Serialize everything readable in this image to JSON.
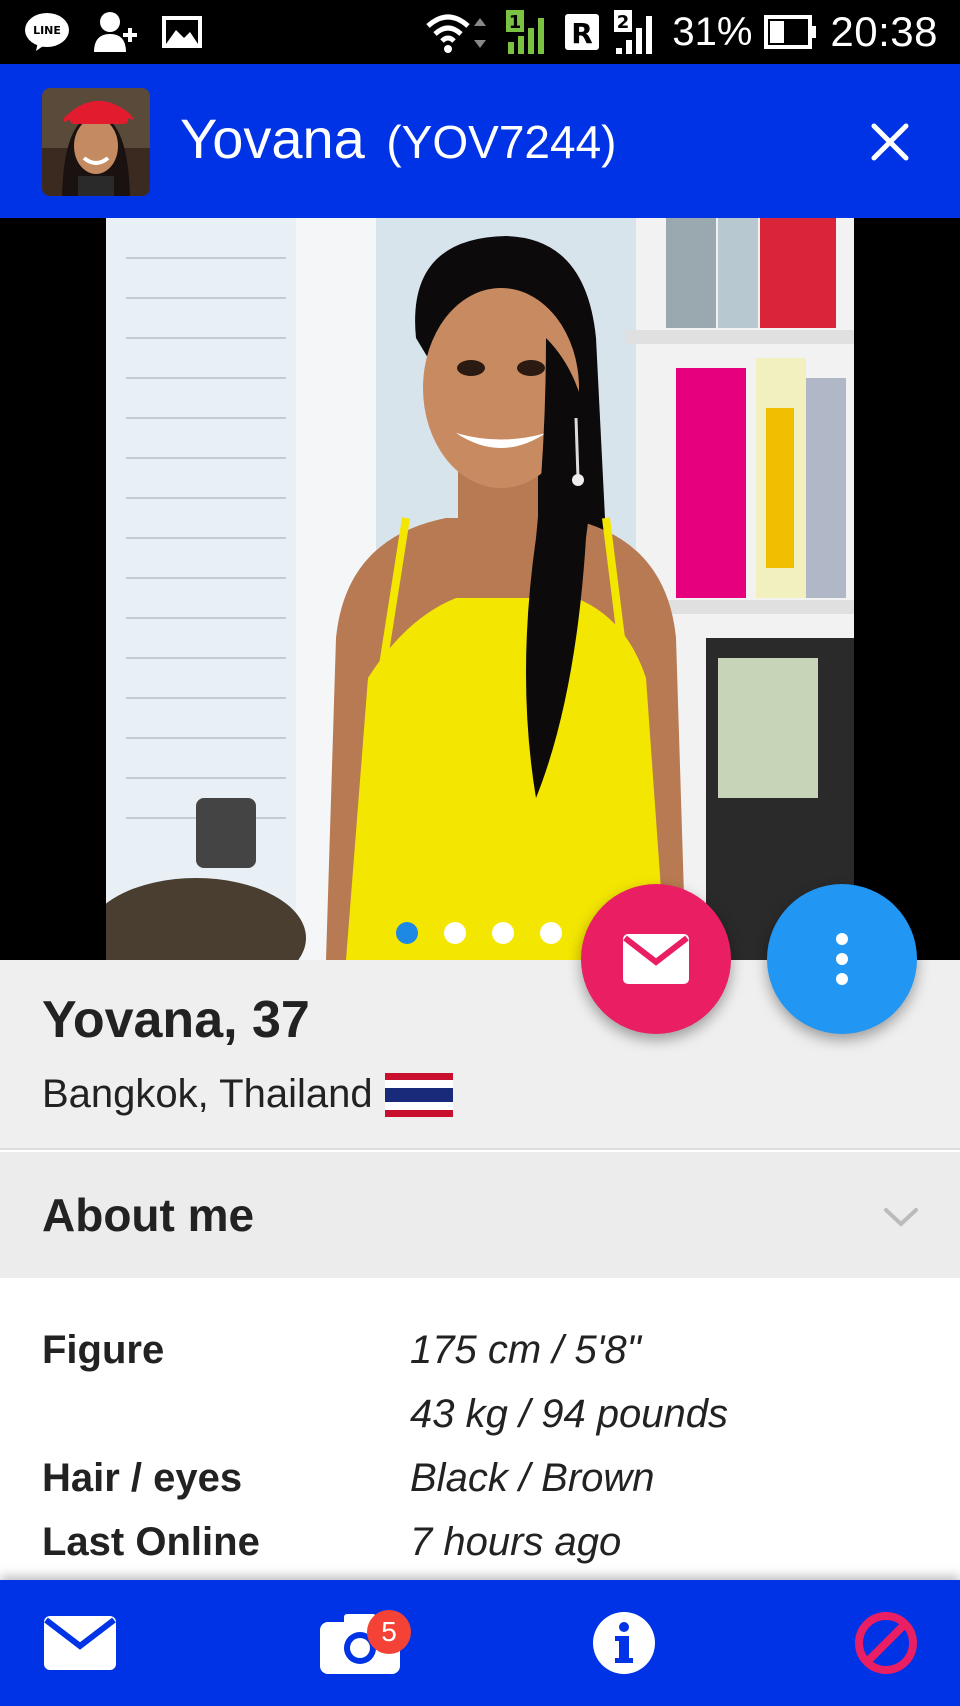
{
  "status_bar": {
    "battery_percent": "31%",
    "time": "20:38",
    "sim_label": "R",
    "sim1_number": "1",
    "sim2_number": "2",
    "line_icon_text": "LINE",
    "icons": [
      "line-app-icon",
      "add-contact-icon",
      "image-icon",
      "wifi-icon",
      "signal-sim1-icon",
      "signal-sim2-icon",
      "battery-icon"
    ]
  },
  "header": {
    "name": "Yovana",
    "code": "(YOV7244)",
    "close_icon": "close-icon"
  },
  "photo": {
    "page_count": 4,
    "active_index": 0
  },
  "profile": {
    "name_age": "Yovana, 37",
    "location": "Bangkok, Thailand",
    "flag": "thailand-flag"
  },
  "about": {
    "title": "About me",
    "rows": [
      {
        "label": "Figure",
        "values": [
          "175 cm / 5'8\"",
          "43 kg / 94 pounds"
        ]
      },
      {
        "label": "Hair / eyes",
        "values": [
          "Black / Brown"
        ]
      },
      {
        "label": "Last Online",
        "values": [
          "7 hours ago"
        ]
      }
    ]
  },
  "bottom_nav": {
    "photos_badge": "5",
    "items": [
      "mail-icon",
      "camera-icon",
      "info-icon",
      "block-icon"
    ]
  },
  "colors": {
    "primary_blue": "#0033e6",
    "fab_pink": "#e91e63",
    "fab_blue": "#2196f3",
    "badge_red": "#f44336",
    "block_red": "#e91e63"
  }
}
